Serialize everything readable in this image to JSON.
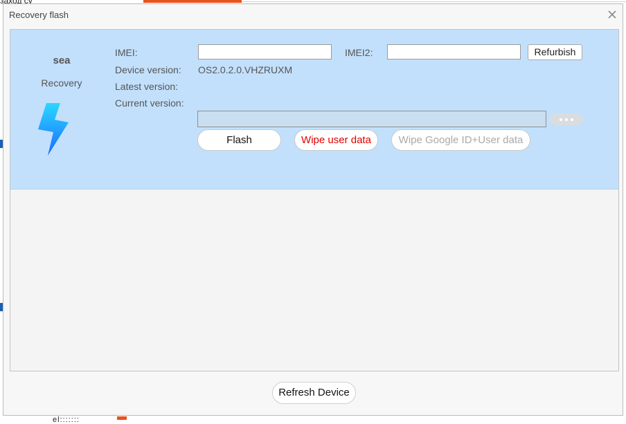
{
  "background": {
    "top_left_text": "заход су",
    "bottom_text": "el:::::::"
  },
  "dialog": {
    "title": "Recovery flash",
    "close_icon": "close-icon"
  },
  "device": {
    "name": "sea",
    "mode": "Recovery",
    "icon": "lightning-bolt-icon"
  },
  "fields": {
    "imei_label": "IMEI:",
    "imei_value": "",
    "imei2_label": "IMEI2:",
    "imei2_value": "",
    "device_version_label": "Device version:",
    "device_version_value": "OS2.0.2.0.VHZRUXM",
    "latest_version_label": "Latest version:",
    "latest_version_value": "",
    "current_version_label": "Current version:",
    "current_version_value": "",
    "file_path_value": ""
  },
  "buttons": {
    "refurbish": "Refurbish",
    "browse": "more-dots-icon",
    "flash": "Flash",
    "wipe_user_data": "Wipe user data",
    "wipe_google": "Wipe Google ID+User data",
    "refresh_device": "Refresh Device"
  },
  "colors": {
    "panel_bg": "#c2e0fc",
    "wipe_text": "#e00000",
    "disabled_text": "#a9a9a9",
    "accent_orange": "#e8531f",
    "bolt_top": "#2ad8ff",
    "bolt_bottom": "#1a6bff"
  }
}
